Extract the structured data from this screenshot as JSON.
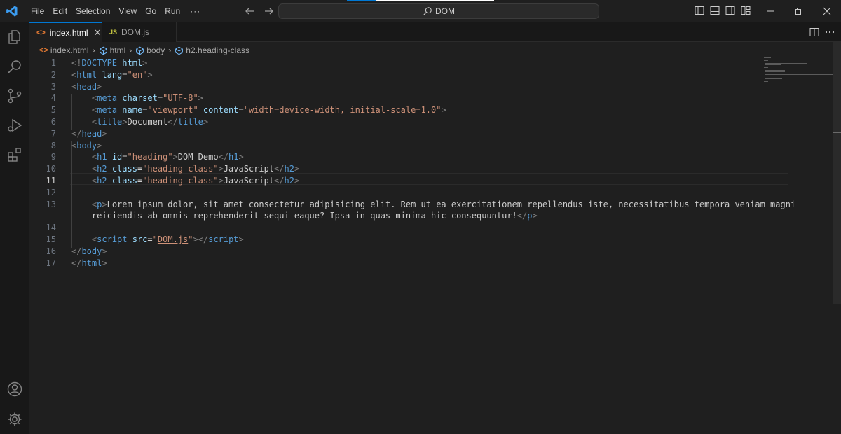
{
  "titlebar": {
    "logo_icon": "vscode-logo-icon",
    "menu": [
      "File",
      "Edit",
      "Selection",
      "View",
      "Go",
      "Run"
    ],
    "menu_more": "···",
    "search_text": "DOM",
    "accent": "#0078d4"
  },
  "tabs": [
    {
      "label": "index.html",
      "icon_text": "<>",
      "active": true,
      "close": "✕"
    },
    {
      "label": "DOM.js",
      "icon_text": "JS",
      "active": false
    }
  ],
  "breadcrumb": {
    "file": "index.html",
    "items": [
      "html",
      "body",
      "h2.heading-class"
    ]
  },
  "editor": {
    "current_line": 11,
    "lines": [
      {
        "n": "1",
        "tokens": [
          [
            "p",
            "<!"
          ],
          [
            "t",
            "DOCTYPE"
          ],
          [
            "x",
            " "
          ],
          [
            "a",
            "html"
          ],
          [
            "p",
            ">"
          ]
        ]
      },
      {
        "n": "2",
        "tokens": [
          [
            "p",
            "<"
          ],
          [
            "t",
            "html"
          ],
          [
            "x",
            " "
          ],
          [
            "a",
            "lang"
          ],
          [
            "x",
            "="
          ],
          [
            "s",
            "\"en\""
          ],
          [
            "p",
            ">"
          ]
        ]
      },
      {
        "n": "3",
        "tokens": [
          [
            "p",
            "<"
          ],
          [
            "t",
            "head"
          ],
          [
            "p",
            ">"
          ]
        ]
      },
      {
        "n": "4",
        "tokens": [
          [
            "x",
            "    "
          ],
          [
            "p",
            "<"
          ],
          [
            "t",
            "meta"
          ],
          [
            "x",
            " "
          ],
          [
            "a",
            "charset"
          ],
          [
            "x",
            "="
          ],
          [
            "s",
            "\"UTF-8\""
          ],
          [
            "p",
            ">"
          ]
        ]
      },
      {
        "n": "5",
        "tokens": [
          [
            "x",
            "    "
          ],
          [
            "p",
            "<"
          ],
          [
            "t",
            "meta"
          ],
          [
            "x",
            " "
          ],
          [
            "a",
            "name"
          ],
          [
            "x",
            "="
          ],
          [
            "s",
            "\"viewport\""
          ],
          [
            "x",
            " "
          ],
          [
            "a",
            "content"
          ],
          [
            "x",
            "="
          ],
          [
            "s",
            "\"width=device-width, initial-scale=1.0\""
          ],
          [
            "p",
            ">"
          ]
        ]
      },
      {
        "n": "6",
        "tokens": [
          [
            "x",
            "    "
          ],
          [
            "p",
            "<"
          ],
          [
            "t",
            "title"
          ],
          [
            "p",
            ">"
          ],
          [
            "x",
            "Document"
          ],
          [
            "p",
            "</"
          ],
          [
            "t",
            "title"
          ],
          [
            "p",
            ">"
          ]
        ]
      },
      {
        "n": "7",
        "tokens": [
          [
            "p",
            "</"
          ],
          [
            "t",
            "head"
          ],
          [
            "p",
            ">"
          ]
        ]
      },
      {
        "n": "8",
        "tokens": [
          [
            "p",
            "<"
          ],
          [
            "t",
            "body"
          ],
          [
            "p",
            ">"
          ]
        ]
      },
      {
        "n": "9",
        "tokens": [
          [
            "x",
            "    "
          ],
          [
            "p",
            "<"
          ],
          [
            "t",
            "h1"
          ],
          [
            "x",
            " "
          ],
          [
            "a",
            "id"
          ],
          [
            "x",
            "="
          ],
          [
            "s",
            "\"heading\""
          ],
          [
            "p",
            ">"
          ],
          [
            "x",
            "DOM Demo"
          ],
          [
            "p",
            "</"
          ],
          [
            "t",
            "h1"
          ],
          [
            "p",
            ">"
          ]
        ]
      },
      {
        "n": "10",
        "tokens": [
          [
            "x",
            "    "
          ],
          [
            "p",
            "<"
          ],
          [
            "t",
            "h2"
          ],
          [
            "x",
            " "
          ],
          [
            "a",
            "class"
          ],
          [
            "x",
            "="
          ],
          [
            "s",
            "\"heading-class\""
          ],
          [
            "p",
            ">"
          ],
          [
            "x",
            "JavaScript"
          ],
          [
            "p",
            "</"
          ],
          [
            "t",
            "h2"
          ],
          [
            "p",
            ">"
          ]
        ]
      },
      {
        "n": "11",
        "tokens": [
          [
            "x",
            "    "
          ],
          [
            "p",
            "<"
          ],
          [
            "t",
            "h2"
          ],
          [
            "x",
            " "
          ],
          [
            "a",
            "class"
          ],
          [
            "x",
            "="
          ],
          [
            "s",
            "\"heading-class\""
          ],
          [
            "p",
            ">"
          ],
          [
            "x",
            "JavaScript"
          ],
          [
            "p",
            "</"
          ],
          [
            "t",
            "h2"
          ],
          [
            "p",
            ">"
          ]
        ]
      },
      {
        "n": "12",
        "tokens": []
      },
      {
        "n": "13",
        "tokens": [
          [
            "x",
            "    "
          ],
          [
            "p",
            "<"
          ],
          [
            "t",
            "p"
          ],
          [
            "p",
            ">"
          ],
          [
            "x",
            "Lorem ipsum dolor, sit amet consectetur adipisicing elit. Rem ut ea exercitationem repellendus iste, necessitatibus tempora veniam magni"
          ]
        ]
      },
      {
        "n": "",
        "tokens": [
          [
            "x",
            "    reiciendis ab omnis reprehenderit sequi eaque? Ipsa in quas minima hic consequuntur!"
          ],
          [
            "p",
            "</"
          ],
          [
            "t",
            "p"
          ],
          [
            "p",
            ">"
          ]
        ]
      },
      {
        "n": "14",
        "tokens": []
      },
      {
        "n": "15",
        "tokens": [
          [
            "x",
            "    "
          ],
          [
            "p",
            "<"
          ],
          [
            "t",
            "script"
          ],
          [
            "x",
            " "
          ],
          [
            "a",
            "src"
          ],
          [
            "x",
            "="
          ],
          [
            "s",
            "\""
          ],
          [
            "sl",
            "DOM.js"
          ],
          [
            "s",
            "\""
          ],
          [
            "p",
            "></"
          ],
          [
            "t",
            "script"
          ],
          [
            "p",
            ">"
          ]
        ]
      },
      {
        "n": "16",
        "tokens": [
          [
            "p",
            "</"
          ],
          [
            "t",
            "body"
          ],
          [
            "p",
            ">"
          ]
        ]
      },
      {
        "n": "17",
        "tokens": [
          [
            "p",
            "</"
          ],
          [
            "t",
            "html"
          ],
          [
            "p",
            ">"
          ]
        ]
      }
    ]
  }
}
